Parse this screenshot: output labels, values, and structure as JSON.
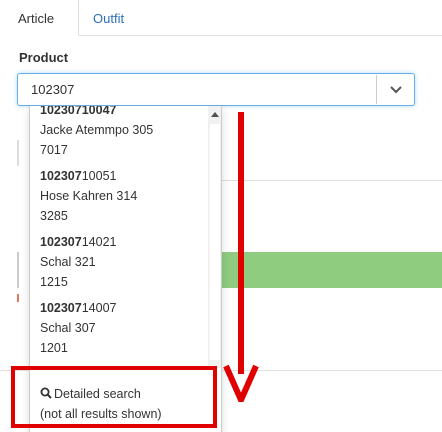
{
  "tabs": [
    {
      "label": "Article",
      "active": true
    },
    {
      "label": "Outfit",
      "active": false
    }
  ],
  "product_label": "Product",
  "select": {
    "value": "102307",
    "chevron_icon": "chevron-down-icon"
  },
  "results": [
    {
      "code_match": "10230710047",
      "code_rest": "",
      "line1": "Jacke Atemmpo 305",
      "line2": "7017"
    },
    {
      "code_match": "102307",
      "code_rest": "10051",
      "line1": "Hose Kahren 314",
      "line2": "3285"
    },
    {
      "code_match": "102307",
      "code_rest": "14021",
      "line1": "Schal 321",
      "line2": "1215"
    },
    {
      "code_match": "102307",
      "code_rest": "14007",
      "line1": "Schal 307",
      "line2": "1201"
    }
  ],
  "detailed_search": {
    "icon": "search-icon",
    "label": "Detailed search",
    "note": "(not all results shown)"
  },
  "colors": {
    "accent": "#2a6fb8",
    "focus": "#66afe9",
    "annotation": "#e00000",
    "success_row": "#8fcc7f"
  }
}
